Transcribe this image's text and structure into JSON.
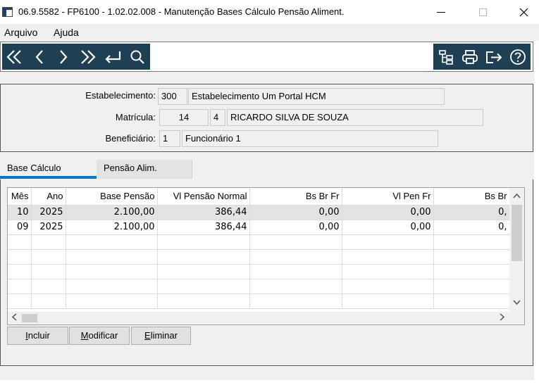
{
  "window": {
    "title": "06.9.5582 - FP6100 - 1.02.02.008 - Manutenção Bases Cálculo Pensão Aliment.",
    "min_label": "—",
    "close_label": "✕"
  },
  "menu": {
    "items": [
      {
        "label": "Arquivo"
      },
      {
        "label": "Ajuda"
      }
    ]
  },
  "toolbar": {
    "left_icons": [
      "first-record-icon",
      "previous-record-icon",
      "next-record-icon",
      "last-record-icon",
      "goto-icon",
      "search-icon"
    ],
    "right_icons": [
      "tree-icon",
      "print-icon",
      "exit-icon",
      "help-icon"
    ],
    "accent": "#1f3f55"
  },
  "header": {
    "estabelecimento": {
      "label": "Estabelecimento:",
      "code": "300",
      "name": "Estabelecimento Um Portal HCM"
    },
    "matricula": {
      "label": "Matrícula:",
      "number": "14",
      "digit": "4",
      "name": "RICARDO SILVA DE SOUZA"
    },
    "beneficiario": {
      "label": "Beneficiário:",
      "code": "1",
      "name": "Funcionário 1"
    }
  },
  "tabs": [
    {
      "label": "Base Cálculo",
      "active": true
    },
    {
      "label": "Pensão Alim.",
      "active": false
    }
  ],
  "grid": {
    "columns": [
      "Mês",
      "Ano",
      "Base Pensão",
      "Vl Pensão Normal",
      "Bs Br Fr",
      "Vl Pen Fr",
      "Bs Br"
    ],
    "rows": [
      [
        "10",
        "2025",
        "2.100,00",
        "386,44",
        "0,00",
        "0,00",
        "0,"
      ],
      [
        "09",
        "2025",
        "2.100,00",
        "386,44",
        "0,00",
        "0,00",
        "0,"
      ]
    ],
    "empty_rows": 5
  },
  "buttons": {
    "incluir": {
      "first": "I",
      "rest": "ncluir"
    },
    "modificar": {
      "first": "M",
      "rest": "odificar"
    },
    "eliminar": {
      "first": "E",
      "rest": "liminar"
    }
  }
}
